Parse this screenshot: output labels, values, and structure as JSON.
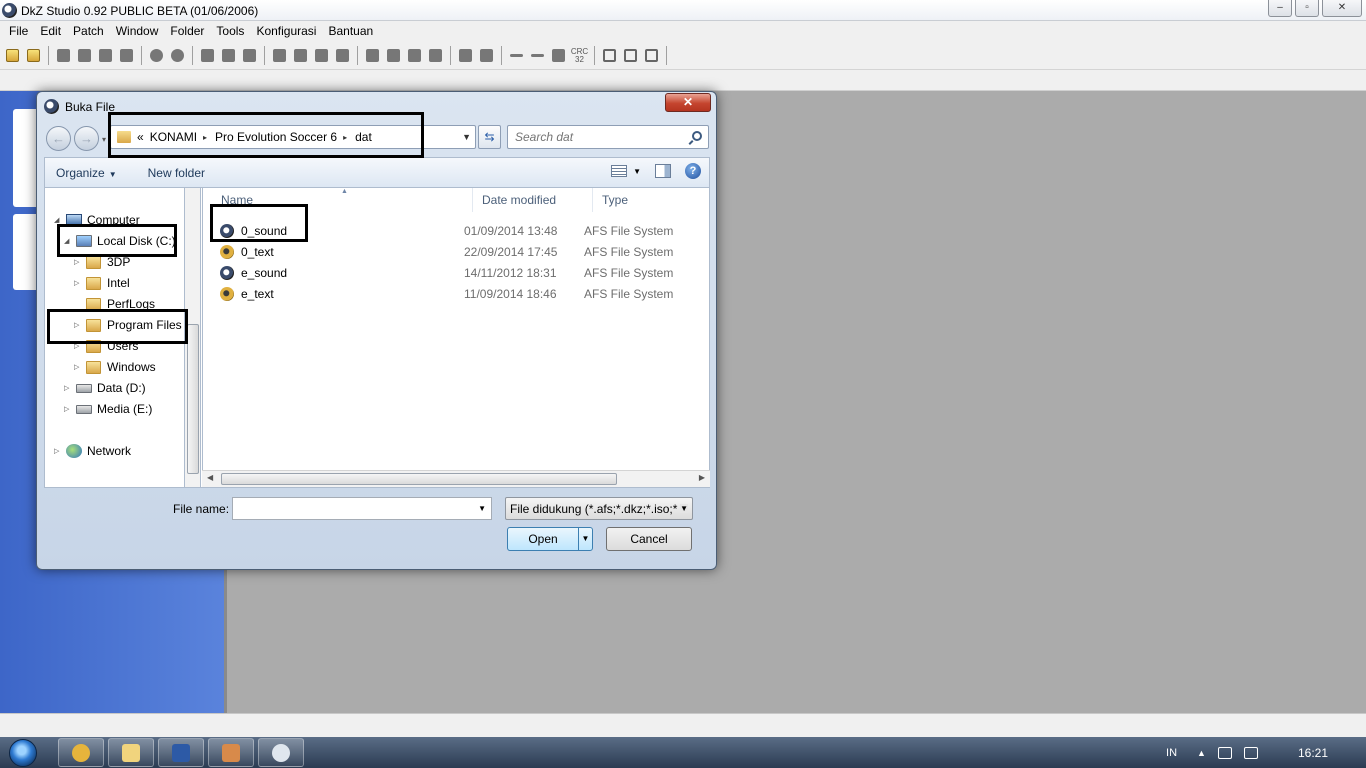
{
  "app": {
    "title": "DkZ Studio 0.92 PUBLIC BETA (01/06/2006)",
    "win_minimize": "–",
    "win_maximize": "▫",
    "win_close": "✕"
  },
  "menu": [
    {
      "label": "File"
    },
    {
      "label": "Edit"
    },
    {
      "label": "Patch"
    },
    {
      "label": "Window"
    },
    {
      "label": "Folder"
    },
    {
      "label": "Tools"
    },
    {
      "label": "Konfigurasi"
    },
    {
      "label": "Bantuan"
    }
  ],
  "toolbar": {
    "crc_label": "CRC 32"
  },
  "dialog": {
    "title": "Buka File",
    "close_label": "✕",
    "back_glyph": "←",
    "forward_glyph": "→",
    "address": {
      "overflow": "«",
      "segments": [
        "KONAMI",
        "Pro Evolution Soccer 6",
        "dat"
      ],
      "separator": "▸"
    },
    "refresh_glyph": "⇆",
    "search_placeholder": "Search dat",
    "commands": {
      "organize": "Organize",
      "new_folder": "New folder",
      "help": "?"
    },
    "tree": [
      {
        "label": "Computer",
        "expander": "◢",
        "icon": "computer-icon"
      },
      {
        "label": "Local Disk (C:)",
        "expander": "◢",
        "icon": "system-drive-icon"
      },
      {
        "label": "3DP",
        "expander": "▷",
        "icon": "folder-icon"
      },
      {
        "label": "Intel",
        "expander": "▷",
        "icon": "folder-icon"
      },
      {
        "label": "PerfLogs",
        "expander": "",
        "icon": "folder-icon"
      },
      {
        "label": "Program Files",
        "expander": "▷",
        "icon": "folder-icon"
      },
      {
        "label": "Users",
        "expander": "▷",
        "icon": "folder-icon"
      },
      {
        "label": "Windows",
        "expander": "▷",
        "icon": "folder-icon"
      },
      {
        "label": "Data (D:)",
        "expander": "▷",
        "icon": "drive-icon"
      },
      {
        "label": "Media (E:)",
        "expander": "▷",
        "icon": "drive-icon"
      },
      {
        "label": "Network",
        "expander": "▷",
        "icon": "network-icon"
      }
    ],
    "columns": {
      "name": "Name",
      "date": "Date modified",
      "type": "Type"
    },
    "files": [
      {
        "name": "0_sound",
        "date": "01/09/2014 13:48",
        "type": "AFS File System",
        "icon": "afs-file-icon"
      },
      {
        "name": "0_text",
        "date": "22/09/2014 17:45",
        "type": "AFS File System",
        "icon": "afs-text-file-icon"
      },
      {
        "name": "e_sound",
        "date": "14/11/2012 18:31",
        "type": "AFS File System",
        "icon": "afs-file-icon"
      },
      {
        "name": "e_text",
        "date": "11/09/2014 18:46",
        "type": "AFS File System",
        "icon": "afs-text-file-icon"
      }
    ],
    "file_name_label": "File name:",
    "file_name_value": "",
    "file_type_filter": "File didukung (*.afs;*.dkz;*.iso;*",
    "open_label": "Open",
    "cancel_label": "Cancel"
  },
  "taskbar": {
    "language": "IN",
    "clock": "16:21",
    "apps": [
      {
        "icon": "chrome-icon",
        "color": "#e6b43c"
      },
      {
        "icon": "explorer-icon",
        "color": "#f1d47d"
      },
      {
        "icon": "word-icon",
        "color": "#2d5aa6"
      },
      {
        "icon": "paint-icon",
        "color": "#d88a4a"
      },
      {
        "icon": "dkz-studio-icon",
        "color": "#dfe6ee"
      }
    ]
  }
}
